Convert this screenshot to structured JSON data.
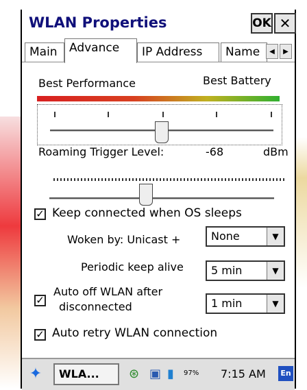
{
  "window": {
    "title": "WLAN Properties",
    "ok_label": "OK",
    "close_label": "✕"
  },
  "tabs": [
    {
      "label": "Main"
    },
    {
      "label": "Advance"
    },
    {
      "label": "IP Address"
    },
    {
      "label": "Name"
    }
  ],
  "performance": {
    "left_label": "Best Performance",
    "right_label": "Best Battery",
    "slider_fraction": 0.5
  },
  "roaming": {
    "label": "Roaming Trigger Level:",
    "value": "-68",
    "unit": "dBm",
    "slider_fraction": 0.43
  },
  "keep_connected": {
    "checked": true,
    "label": "Keep connected when OS sleeps"
  },
  "woken_by": {
    "label": "Woken by: Unicast +",
    "value": "None"
  },
  "keep_alive": {
    "label": "Periodic keep alive",
    "value": "5 min"
  },
  "auto_off": {
    "checked": true,
    "label_line1": "Auto off WLAN after",
    "label_line2": "disconnected",
    "value": "1 min"
  },
  "auto_retry": {
    "checked": true,
    "label": "Auto retry WLAN connection"
  },
  "taskbar": {
    "app_label": "WLA...",
    "battery": "97%",
    "clock": "7:15 AM",
    "input_method": "En"
  },
  "colors": {
    "title_text": "#10107a",
    "bar_red": "#d82020",
    "bar_green": "#30b030"
  }
}
